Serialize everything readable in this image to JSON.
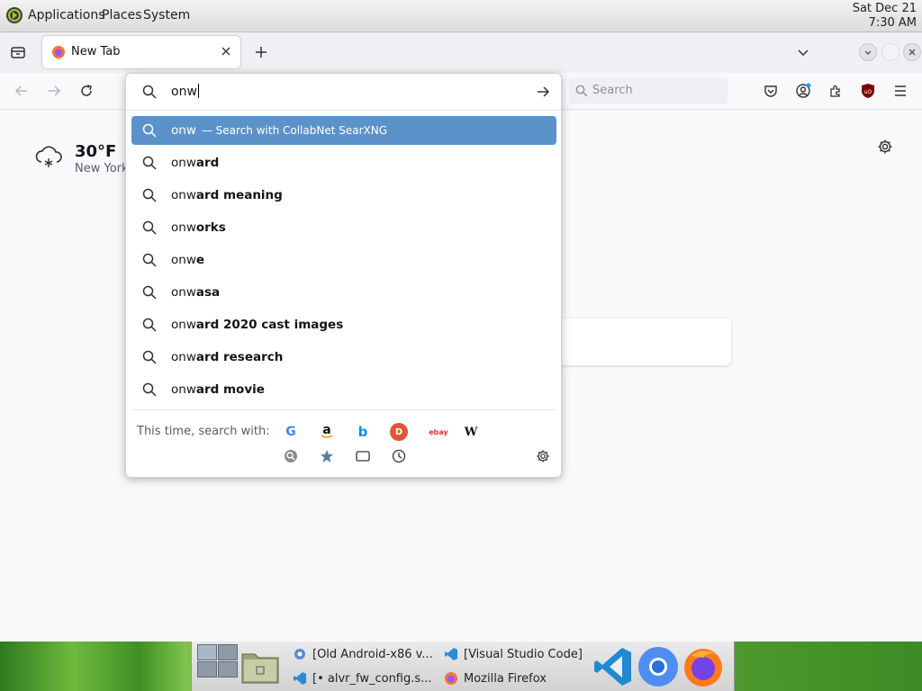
{
  "system_panel": {
    "menus": [
      "Applications",
      "Places",
      "System"
    ],
    "clock_date": "Sat Dec 21",
    "clock_time": "7:30 AM"
  },
  "browser": {
    "tab_title": "New Tab",
    "search_placeholder": "Search"
  },
  "weather": {
    "temperature": "30°F",
    "location": "New York"
  },
  "urlbar": {
    "typed": "onw",
    "suggestions": [
      {
        "prefix": "onw",
        "rest": "",
        "action": "— Search with CollabNet SearXNG",
        "selected": true
      },
      {
        "prefix": "onw",
        "rest": "ard",
        "action": "",
        "selected": false
      },
      {
        "prefix": "onw",
        "rest": "ard meaning",
        "action": "",
        "selected": false
      },
      {
        "prefix": "onw",
        "rest": "orks",
        "action": "",
        "selected": false
      },
      {
        "prefix": "onw",
        "rest": "e",
        "action": "",
        "selected": false
      },
      {
        "prefix": "onw",
        "rest": "asa",
        "action": "",
        "selected": false
      },
      {
        "prefix": "onw",
        "rest": "ard 2020 cast images",
        "action": "",
        "selected": false
      },
      {
        "prefix": "onw",
        "rest": "ard research",
        "action": "",
        "selected": false
      },
      {
        "prefix": "onw",
        "rest": "ard movie",
        "action": "",
        "selected": false
      }
    ],
    "oneoff_label": "This time, search with:",
    "engines": [
      "google",
      "amazon",
      "bing",
      "duckduckgo",
      "ebay",
      "wikipedia"
    ],
    "engine_glyphs": {
      "google": "G",
      "amazon": "a",
      "bing": "b",
      "duckduckgo": "D",
      "ebay": "ebay",
      "wikipedia": "W"
    }
  },
  "taskbar": {
    "tasks": [
      "[Old Android-x86 v...",
      "[Visual Studio Code]",
      "[• alvr_fw_config.s...",
      "Mozilla Firefox"
    ]
  }
}
